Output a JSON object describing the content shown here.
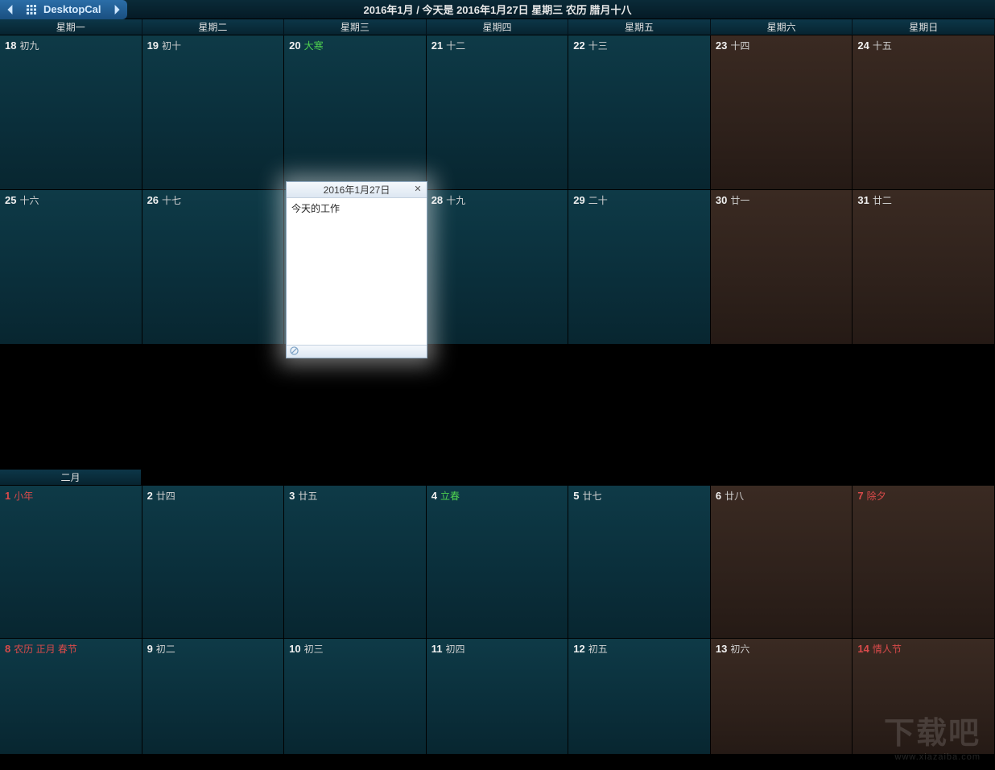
{
  "topbar": {
    "app_title": "DesktopCal",
    "center_text": "2016年1月 / 今天是 2016年1月27日 星期三 农历 腊月十八"
  },
  "weekdays": [
    "星期一",
    "星期二",
    "星期三",
    "星期四",
    "星期五",
    "星期六",
    "星期日"
  ],
  "month_label_feb": "二月",
  "rows": [
    {
      "h": "h-full",
      "cells": [
        {
          "num": "18",
          "lunar": "初九"
        },
        {
          "num": "19",
          "lunar": "初十"
        },
        {
          "num": "20",
          "lunar": "大寒",
          "lcolor": "green"
        },
        {
          "num": "21",
          "lunar": "十二"
        },
        {
          "num": "22",
          "lunar": "十三"
        },
        {
          "num": "23",
          "lunar": "十四",
          "weekend": true
        },
        {
          "num": "24",
          "lunar": "十五",
          "weekend": true
        }
      ]
    },
    {
      "h": "h-full",
      "cells": [
        {
          "num": "25",
          "lunar": "十六"
        },
        {
          "num": "26",
          "lunar": "十七"
        },
        {
          "num": "",
          "lunar": "",
          "today": true
        },
        {
          "num": "28",
          "lunar": "十九"
        },
        {
          "num": "29",
          "lunar": "二十"
        },
        {
          "num": "30",
          "lunar": "廿一",
          "weekend": true
        },
        {
          "num": "31",
          "lunar": "廿二",
          "weekend": true
        }
      ]
    },
    {
      "h": "h-feb",
      "cells": [
        {
          "num": "1",
          "lunar": "小年",
          "ncolor": "red",
          "lcolor": "red"
        },
        {
          "num": "2",
          "lunar": "廿四"
        },
        {
          "num": "3",
          "lunar": "廿五"
        },
        {
          "num": "4",
          "lunar": "立春",
          "lcolor": "green"
        },
        {
          "num": "5",
          "lunar": "廿七"
        },
        {
          "num": "6",
          "lunar": "廿八",
          "weekend": true
        },
        {
          "num": "7",
          "lunar": "除夕",
          "ncolor": "red",
          "lcolor": "red",
          "weekend": true
        }
      ]
    },
    {
      "h": "h-last",
      "cells": [
        {
          "num": "8",
          "lunar": "农历 正月 春节",
          "ncolor": "red",
          "lcolor": "red"
        },
        {
          "num": "9",
          "lunar": "初二"
        },
        {
          "num": "10",
          "lunar": "初三"
        },
        {
          "num": "11",
          "lunar": "初四"
        },
        {
          "num": "12",
          "lunar": "初五"
        },
        {
          "num": "13",
          "lunar": "初六",
          "weekend": true
        },
        {
          "num": "14",
          "lunar": "情人节",
          "ncolor": "red",
          "lcolor": "red",
          "weekend": true
        }
      ]
    }
  ],
  "popup": {
    "title": "2016年1月27日",
    "content": "今天的工作"
  },
  "watermark": {
    "big": "下载吧",
    "small": "www.xiazaiba.com"
  }
}
